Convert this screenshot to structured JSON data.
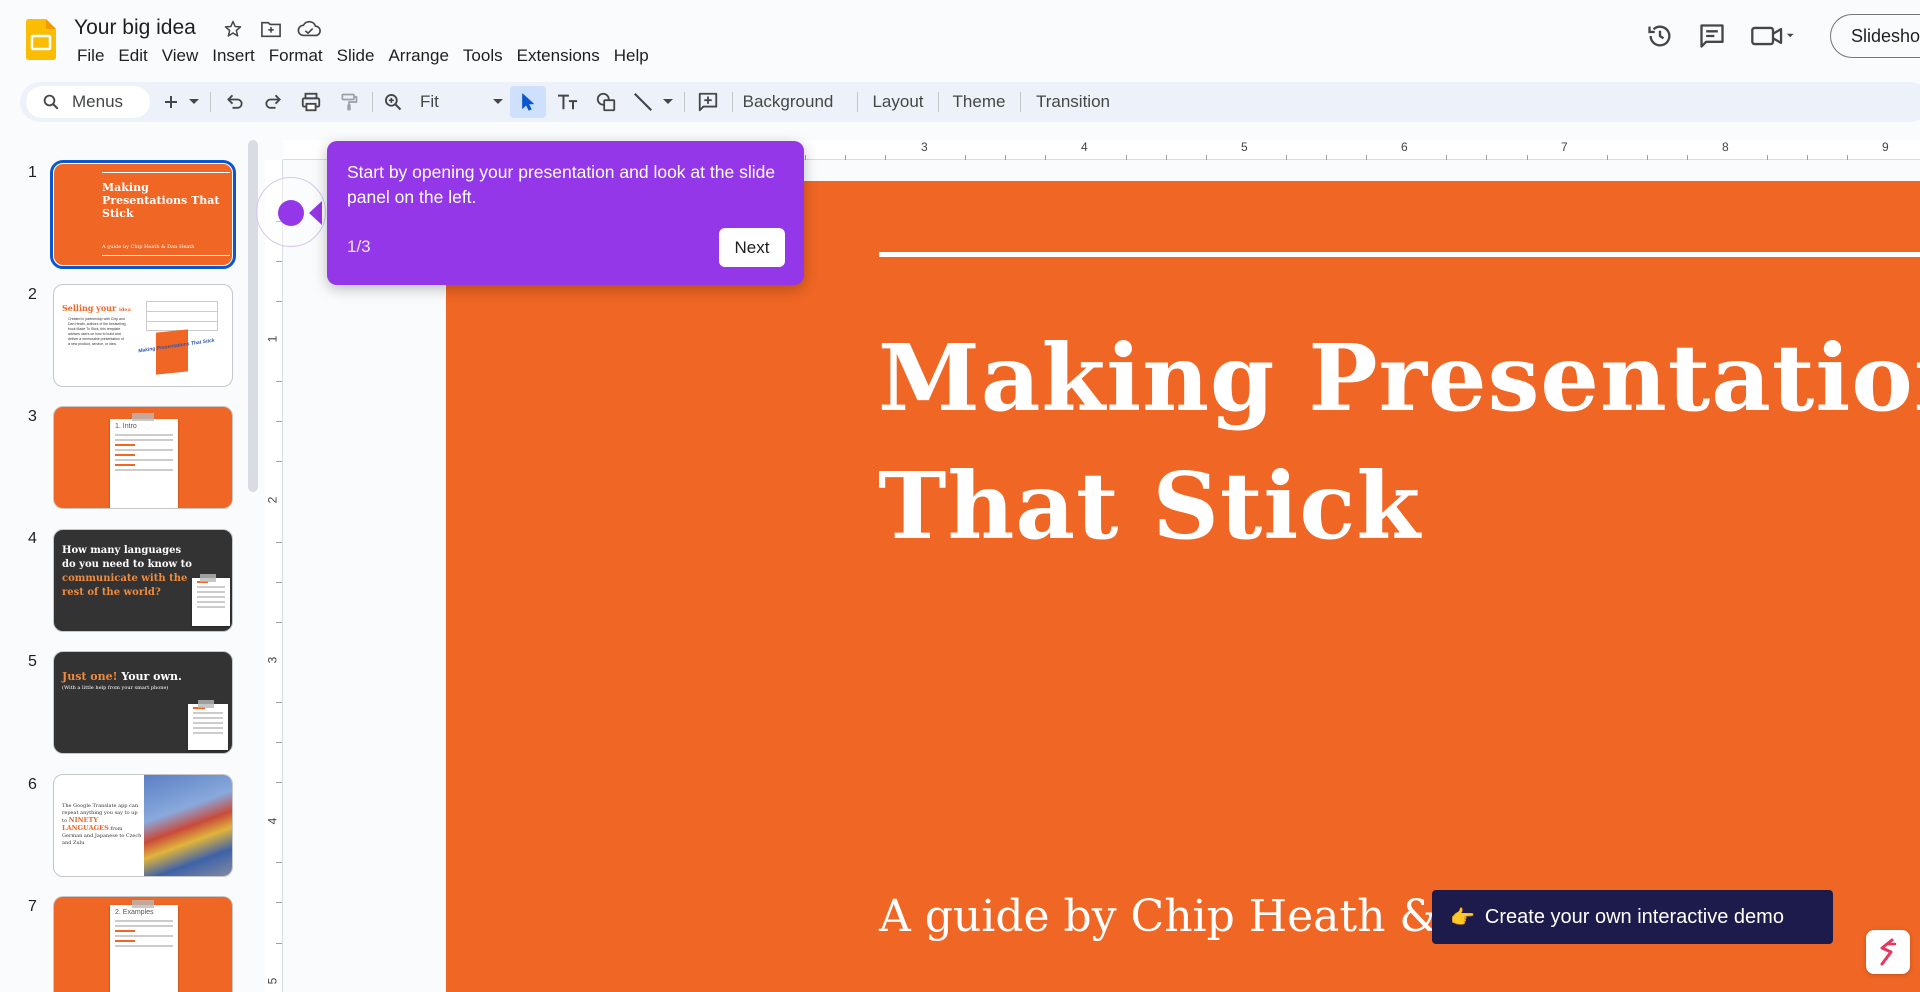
{
  "app": {
    "doc_title": "Your big idea",
    "menus": [
      "File",
      "Edit",
      "View",
      "Insert",
      "Format",
      "Slide",
      "Arrange",
      "Tools",
      "Extensions",
      "Help"
    ],
    "slideshow_label": "Slideshow"
  },
  "toolbar": {
    "search_label": "Menus",
    "zoom_label": "Fit",
    "background_label": "Background",
    "layout_label": "Layout",
    "theme_label": "Theme",
    "transition_label": "Transition"
  },
  "ruler": {
    "top": [
      "3",
      "4",
      "5",
      "6",
      "7",
      "8",
      "9"
    ],
    "left": [
      "1",
      "2",
      "3",
      "4",
      "5"
    ]
  },
  "slides_panel": {
    "numbers": [
      "1",
      "2",
      "3",
      "4",
      "5",
      "6",
      "7"
    ],
    "s1_title": "Making Presentations That Stick",
    "s1_sub": "A guide by Chip Heath & Dan Heath",
    "s2_title": "Selling your",
    "s2_idea": "idea",
    "s2_body": "Created in partnership with Chip and Dan Heath, authors of the bestselling book Made To Stick, this template advises users on how to build and deliver a memorable presentation of a new product, service, or idea.",
    "s2_book": "Making Presentations That Stick",
    "s3_title": "1. Intro",
    "s4_line1": "How many languages do you need to know to",
    "s4_line2": "communicate with the rest of the world?",
    "s5_just": "Just one!",
    "s5_own": "Your own.",
    "s5_sub": "(With a little help from your smart phone)",
    "s6_text1": "The Google Translate app can repeat anything you say to up to",
    "s6_highlight": "NINETY LANGUAGES",
    "s6_text2": "from German and Japanese to Czech and Zulu",
    "s7_title": "2. Examples"
  },
  "slide": {
    "title_line1": "Making Presentations",
    "title_line2": "That Stick",
    "subtitle": "A guide by Chip Heath & Dan Heath"
  },
  "tooltip": {
    "text": "Start by opening your presentation and look at the slide panel on the left.",
    "step": "1/3",
    "next_label": "Next"
  },
  "demo": {
    "emoji": "👉",
    "label": "Create your own interactive demo"
  },
  "colors": {
    "slide_orange": "#f06624",
    "tooltip_purple": "#9437e8",
    "selection_blue": "#0b57d0",
    "demo_navy": "#1d1b4b"
  }
}
